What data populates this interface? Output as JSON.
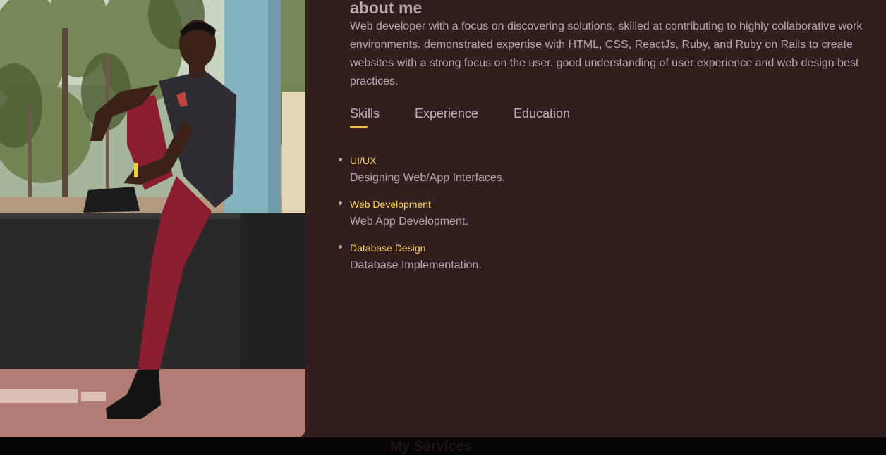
{
  "about": {
    "title": "about me",
    "description": "Web developer with a focus on discovering solutions, skilled at contributing to highly collaborative work environments. demonstrated expertise with HTML, CSS, ReactJs, Ruby, and Ruby on Rails to create websites with a strong focus on the user. good understanding of user experience and web design best practices."
  },
  "tabs": [
    {
      "label": "Skills",
      "active": true
    },
    {
      "label": "Experience",
      "active": false
    },
    {
      "label": "Education",
      "active": false
    }
  ],
  "skills": [
    {
      "name": "UI/UX",
      "description": "Designing Web/App Interfaces."
    },
    {
      "name": "Web Development",
      "description": "Web App Development."
    },
    {
      "name": "Database Design",
      "description": "Database Implementation."
    }
  ],
  "next_section": {
    "title": "My Services"
  },
  "colors": {
    "background": "#331e1e",
    "accent": "#f7c64f",
    "skill_name": "#f7d25e",
    "text": "#b4aaaa"
  }
}
